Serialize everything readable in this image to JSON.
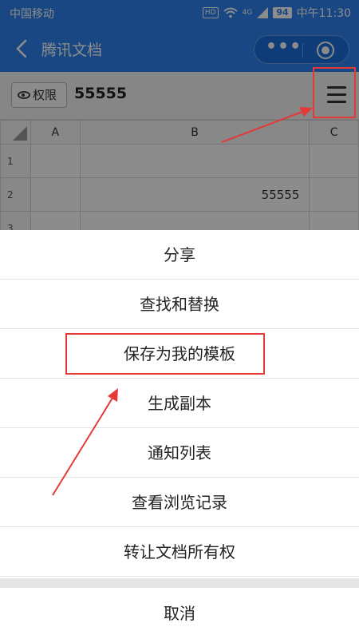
{
  "status_bar": {
    "carrier": "中国移动",
    "network": "HD",
    "signal": "4G",
    "battery": "94",
    "time": "中午11:30"
  },
  "title_bar": {
    "title": "腾讯文档",
    "more_icon": "more-dots-icon",
    "close_icon": "target-icon"
  },
  "doc": {
    "permission_label": "权限",
    "name": "55555",
    "columns": [
      "A",
      "B",
      "C"
    ],
    "rows": [
      {
        "num": "1",
        "cells": [
          "",
          "",
          ""
        ]
      },
      {
        "num": "2",
        "cells": [
          "",
          "55555",
          ""
        ]
      },
      {
        "num": "3",
        "cells": [
          "",
          "",
          ""
        ]
      }
    ]
  },
  "sheet": {
    "items": [
      "分享",
      "查找和替换",
      "保存为我的模板",
      "生成副本",
      "通知列表",
      "查看浏览记录",
      "转让文档所有权"
    ],
    "cancel": "取消"
  },
  "colors": {
    "primary": "#2d82ef",
    "annotation": "#e53935"
  }
}
